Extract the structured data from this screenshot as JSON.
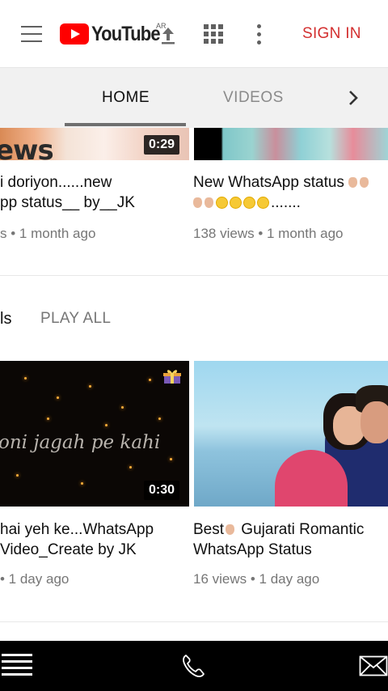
{
  "header": {
    "logo_text": "YouTube",
    "logo_sup": "AR",
    "signin_label": "SIGN IN",
    "icons": [
      "menu-icon",
      "youtube-logo",
      "upload-icon",
      "apps-grid-icon",
      "more-vert-icon"
    ]
  },
  "tabs": {
    "items": [
      {
        "label": "HOME",
        "active": true
      },
      {
        "label": "VIDEOS",
        "active": false
      }
    ],
    "next_icon": "chevron-right-icon"
  },
  "row1": [
    {
      "thumb_text": "ews",
      "duration": "0:29",
      "title_line1": "i doriyon......new",
      "title_line2": "pp status__ by__JK",
      "meta": "s • 1 month ago"
    },
    {
      "title_line1": "New WhatsApp status",
      "title_line2_suffix": ".......",
      "meta": "138 views • 1 month ago"
    }
  ],
  "section": {
    "title": "ls",
    "play_all": "PLAY ALL"
  },
  "row2": [
    {
      "thumb_text": "oni jagah pe kahi",
      "duration": "0:30",
      "title_line1": "hai yeh ke...WhatsApp",
      "title_line2": "Video_Create by JK",
      "meta": "• 1 day ago"
    },
    {
      "title_line1_a": "Best",
      "title_line1_b": " Gujarati Romantic",
      "title_line2": "WhatsApp Status",
      "meta": "16 views • 1 day ago"
    }
  ],
  "bottom_bar": {
    "icons": [
      "menu-lines-icon",
      "phone-icon",
      "mail-icon"
    ]
  },
  "colors": {
    "brand_red": "#ff0000",
    "signin_red": "#d32f2f",
    "tab_bg": "#f1f1f1",
    "meta_gray": "#767676"
  }
}
